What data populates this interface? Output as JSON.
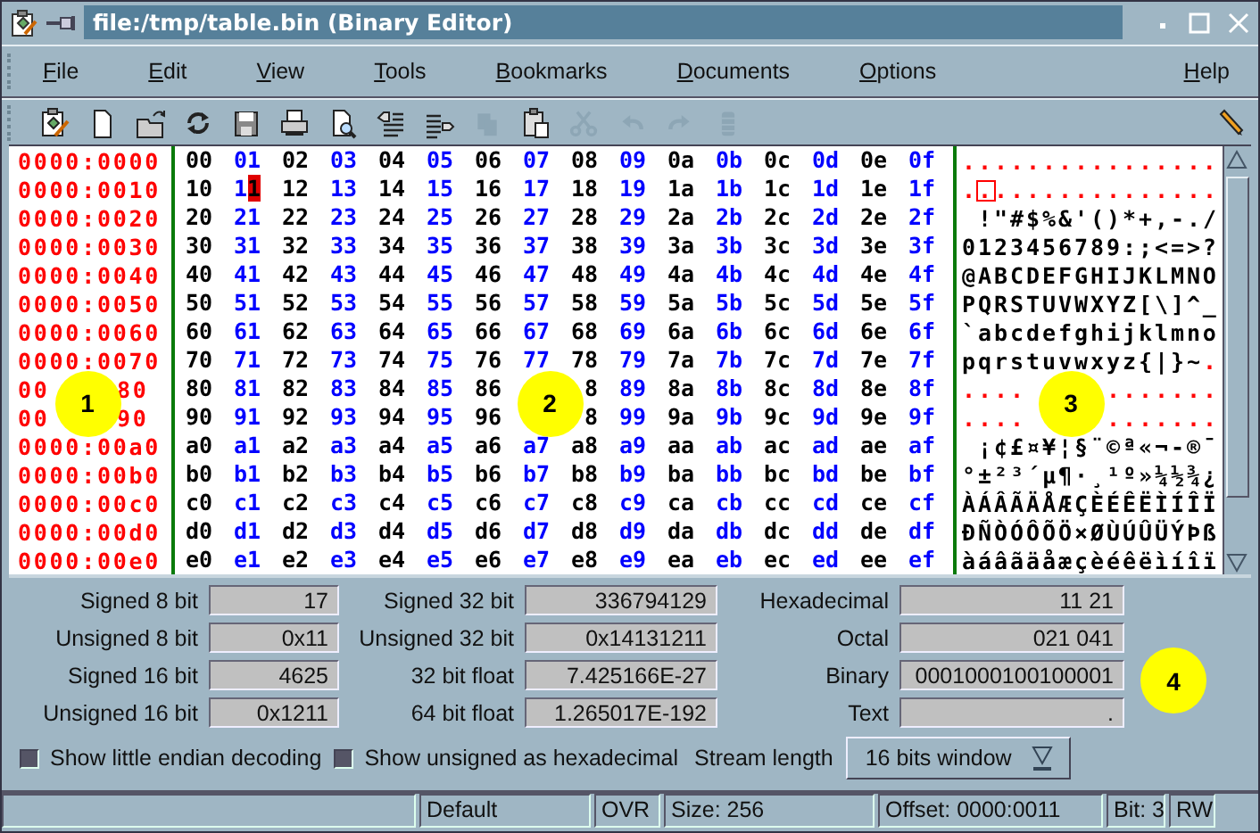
{
  "window": {
    "title": "file:/tmp/table.bin (Binary Editor)"
  },
  "menus": [
    {
      "label": "File"
    },
    {
      "label": "Edit"
    },
    {
      "label": "View"
    },
    {
      "label": "Tools"
    },
    {
      "label": "Bookmarks"
    },
    {
      "label": "Documents"
    },
    {
      "label": "Options"
    }
  ],
  "help_menu": {
    "label": "Help"
  },
  "toolbar": [
    {
      "kind": "properties",
      "disabled": false
    },
    {
      "kind": "new",
      "disabled": false
    },
    {
      "kind": "open",
      "disabled": false
    },
    {
      "kind": "reload",
      "disabled": false
    },
    {
      "kind": "save",
      "disabled": false
    },
    {
      "kind": "print",
      "disabled": false
    },
    {
      "kind": "preview",
      "disabled": false
    },
    {
      "kind": "unindent",
      "disabled": false
    },
    {
      "kind": "indent",
      "disabled": false
    },
    {
      "kind": "copy",
      "disabled": true
    },
    {
      "kind": "paste",
      "disabled": false
    },
    {
      "kind": "cut",
      "disabled": true
    },
    {
      "kind": "undo",
      "disabled": true
    },
    {
      "kind": "redo",
      "disabled": true
    },
    {
      "kind": "spool",
      "disabled": true
    }
  ],
  "editor": {
    "rows": [
      {
        "offset": "0000:0000",
        "bytes": [
          "00",
          "01",
          "02",
          "03",
          "04",
          "05",
          "06",
          "07",
          "08",
          "09",
          "0a",
          "0b",
          "0c",
          "0d",
          "0e",
          "0f"
        ],
        "ascii": [
          {
            "text": "................",
            "kind": "unprintable",
            "cursor": false
          }
        ]
      },
      {
        "offset": "0000:0010",
        "bytes": [
          "10",
          {
            "lead": "1",
            "cursor": "1"
          },
          "12",
          "13",
          "14",
          "15",
          "16",
          "17",
          "18",
          "19",
          "1a",
          "1b",
          "1c",
          "1d",
          "1e",
          "1f"
        ],
        "ascii": [
          {
            "text": ".",
            "kind": "unprintable",
            "cursor": false
          },
          {
            "text": ".",
            "kind": "unprintable",
            "cursor": true
          },
          {
            "text": "..............",
            "kind": "unprintable",
            "cursor": false
          }
        ]
      },
      {
        "offset": "0000:0020",
        "bytes": [
          "20",
          "21",
          "22",
          "23",
          "24",
          "25",
          "26",
          "27",
          "28",
          "29",
          "2a",
          "2b",
          "2c",
          "2d",
          "2e",
          "2f"
        ],
        "ascii": [
          {
            "text": " !\"#$%&'()*+,-./",
            "kind": "char",
            "cursor": false
          }
        ]
      },
      {
        "offset": "0000:0030",
        "bytes": [
          "30",
          "31",
          "32",
          "33",
          "34",
          "35",
          "36",
          "37",
          "38",
          "39",
          "3a",
          "3b",
          "3c",
          "3d",
          "3e",
          "3f"
        ],
        "ascii": [
          {
            "text": "0123456789:;<=>?",
            "kind": "char",
            "cursor": false
          }
        ]
      },
      {
        "offset": "0000:0040",
        "bytes": [
          "40",
          "41",
          "42",
          "43",
          "44",
          "45",
          "46",
          "47",
          "48",
          "49",
          "4a",
          "4b",
          "4c",
          "4d",
          "4e",
          "4f"
        ],
        "ascii": [
          {
            "text": "@ABCDEFGHIJKLMNO",
            "kind": "char",
            "cursor": false
          }
        ]
      },
      {
        "offset": "0000:0050",
        "bytes": [
          "50",
          "51",
          "52",
          "53",
          "54",
          "55",
          "56",
          "57",
          "58",
          "59",
          "5a",
          "5b",
          "5c",
          "5d",
          "5e",
          "5f"
        ],
        "ascii": [
          {
            "text": "PQRSTUVWXYZ[\\]^_",
            "kind": "char",
            "cursor": false
          }
        ]
      },
      {
        "offset": "0000:0060",
        "bytes": [
          "60",
          "61",
          "62",
          "63",
          "64",
          "65",
          "66",
          "67",
          "68",
          "69",
          "6a",
          "6b",
          "6c",
          "6d",
          "6e",
          "6f"
        ],
        "ascii": [
          {
            "text": "`abcdefghijklmno",
            "kind": "char",
            "cursor": false
          }
        ]
      },
      {
        "offset": "0000:0070",
        "bytes": [
          "70",
          "71",
          "72",
          "73",
          "74",
          "75",
          "76",
          "77",
          "78",
          "79",
          "7a",
          "7b",
          "7c",
          "7d",
          "7e",
          "7f"
        ],
        "ascii": [
          {
            "text": "pqrstuvwxyz{|}~",
            "kind": "char",
            "cursor": false
          },
          {
            "text": ".",
            "kind": "unprintable",
            "cursor": false
          }
        ]
      },
      {
        "offset": "00     80",
        "bytes": [
          "80",
          "81",
          "82",
          "83",
          "84",
          "85",
          "86",
          {
            "kind": "covered"
          },
          {
            "tail": "8"
          },
          "89",
          "8a",
          "8b",
          "8c",
          "8d",
          "8e",
          "8f"
        ],
        "ascii": [
          {
            "text": "....     .......",
            "kind": "unprintable",
            "cursor": false
          }
        ]
      },
      {
        "offset": "00     90",
        "bytes": [
          "90",
          "91",
          "92",
          "93",
          "94",
          "95",
          "96",
          {
            "kind": "covered"
          },
          {
            "tail": "8"
          },
          "99",
          "9a",
          "9b",
          "9c",
          "9d",
          "9e",
          "9f"
        ],
        "ascii": [
          {
            "text": "....     .......",
            "kind": "unprintable",
            "cursor": false
          }
        ]
      },
      {
        "offset": "0000:00a0",
        "bytes": [
          "a0",
          "a1",
          "a2",
          "a3",
          "a4",
          "a5",
          "a6",
          "a7",
          "a8",
          "a9",
          "aa",
          "ab",
          "ac",
          "ad",
          "ae",
          "af"
        ],
        "ascii": [
          {
            "text": " ¡¢£¤¥¦§¨©ª«¬-®¯",
            "kind": "char",
            "cursor": false
          }
        ]
      },
      {
        "offset": "0000:00b0",
        "bytes": [
          "b0",
          "b1",
          "b2",
          "b3",
          "b4",
          "b5",
          "b6",
          "b7",
          "b8",
          "b9",
          "ba",
          "bb",
          "bc",
          "bd",
          "be",
          "bf"
        ],
        "ascii": [
          {
            "text": "°±²³´µ¶·¸¹º»¼½¾¿",
            "kind": "char",
            "cursor": false
          }
        ]
      },
      {
        "offset": "0000:00c0",
        "bytes": [
          "c0",
          "c1",
          "c2",
          "c3",
          "c4",
          "c5",
          "c6",
          "c7",
          "c8",
          "c9",
          "ca",
          "cb",
          "cc",
          "cd",
          "ce",
          "cf"
        ],
        "ascii": [
          {
            "text": "ÀÁÂÃÄÅÆÇÈÉÊËÌÍÎÏ",
            "kind": "char",
            "cursor": false
          }
        ]
      },
      {
        "offset": "0000:00d0",
        "bytes": [
          "d0",
          "d1",
          "d2",
          "d3",
          "d4",
          "d5",
          "d6",
          "d7",
          "d8",
          "d9",
          "da",
          "db",
          "dc",
          "dd",
          "de",
          "df"
        ],
        "ascii": [
          {
            "text": "ÐÑÒÓÔÕÖ×ØÙÚÛÜÝÞß",
            "kind": "char",
            "cursor": false
          }
        ]
      },
      {
        "offset": "0000:00e0",
        "bytes": [
          "e0",
          "e1",
          "e2",
          "e3",
          "e4",
          "e5",
          "e6",
          "e7",
          "e8",
          "e9",
          "ea",
          "eb",
          "ec",
          "ed",
          "ee",
          "ef"
        ],
        "ascii": [
          {
            "text": "àáâãäåæçèéêëìíîï",
            "kind": "char",
            "cursor": false
          }
        ]
      }
    ]
  },
  "decoding": {
    "fields": [
      {
        "label": "Signed 8 bit",
        "value": "17"
      },
      {
        "label": "Signed 32 bit",
        "value": "336794129"
      },
      {
        "label": "Hexadecimal",
        "value": "11 21"
      },
      {
        "label": "Unsigned 8 bit",
        "value": "0x11"
      },
      {
        "label": "Unsigned 32 bit",
        "value": "0x14131211"
      },
      {
        "label": "Octal",
        "value": "021 041"
      },
      {
        "label": "Signed 16 bit",
        "value": "4625"
      },
      {
        "label": "32 bit float",
        "value": "7.425166E-27"
      },
      {
        "label": "Binary",
        "value": "0001000100100001"
      },
      {
        "label": "Unsigned 16 bit",
        "value": "0x1211"
      },
      {
        "label": "64 bit float",
        "value": "1.265017E-192"
      },
      {
        "label": "Text",
        "value": "."
      }
    ],
    "checkboxes": [
      {
        "label": "Show little endian decoding",
        "checked": false
      },
      {
        "label": "Show unsigned as hexadecimal",
        "checked": false
      }
    ],
    "stream_length": {
      "label": "Stream length",
      "value": "16 bits window"
    }
  },
  "status_bar": [
    "Default",
    "OVR",
    "Size: 256",
    "Offset: 0000:0011",
    "Bit: 3",
    "RW"
  ],
  "callouts": [
    {
      "label": "1"
    },
    {
      "label": "2"
    },
    {
      "label": "3"
    },
    {
      "label": "4"
    }
  ]
}
